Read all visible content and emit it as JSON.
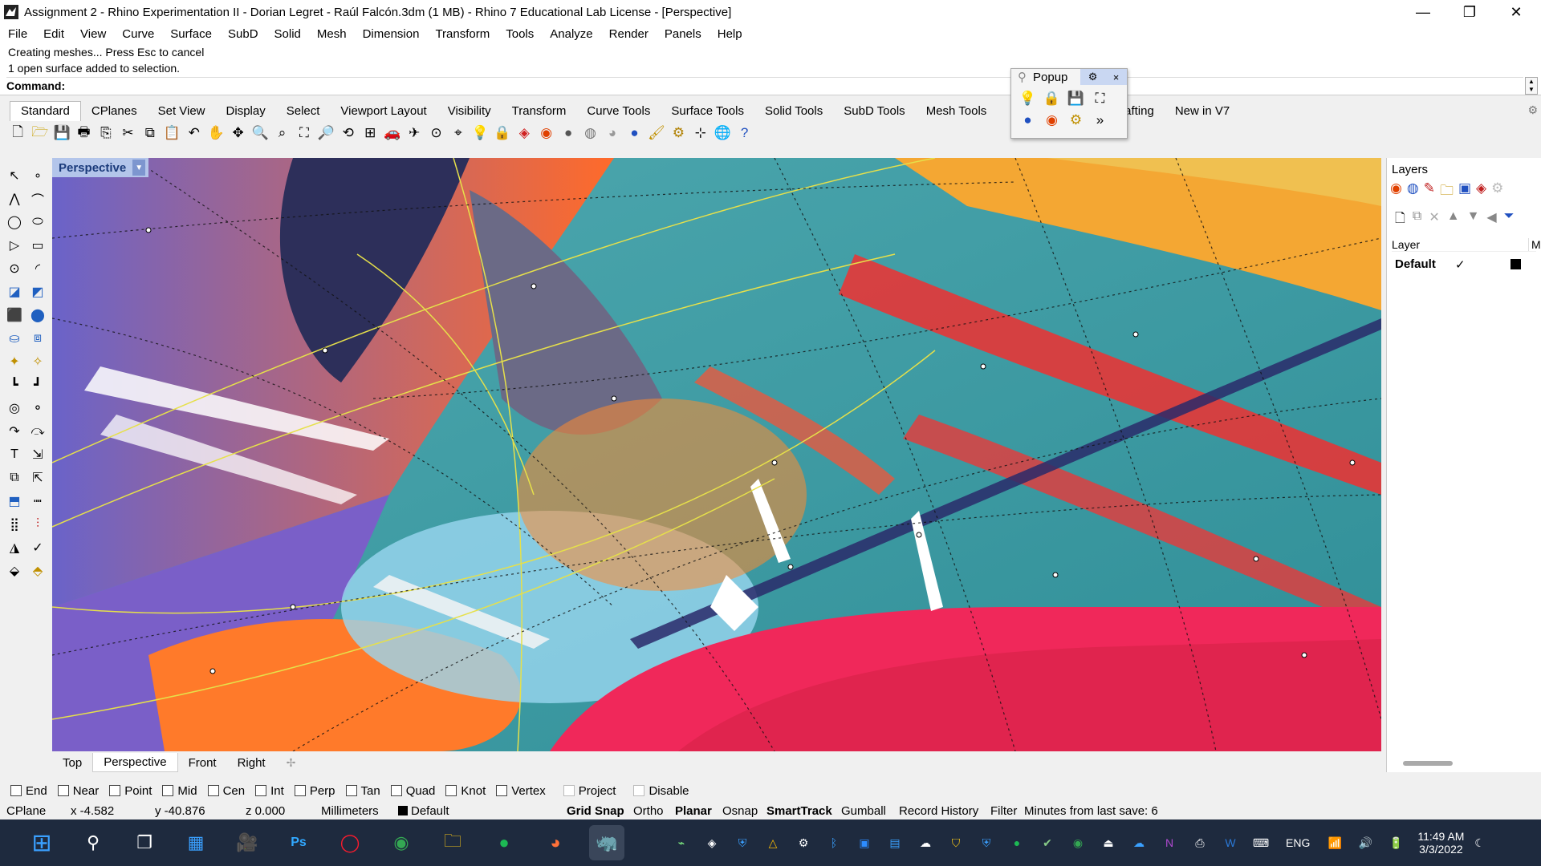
{
  "window": {
    "title": "Assignment 2 - Rhino Experimentation II - Dorian Legret - Raúl Falcón.3dm (1 MB) - Rhino 7 Educational Lab License - [Perspective]",
    "minimize_glyph": "—",
    "maximize_glyph": "❐",
    "close_glyph": "✕"
  },
  "menu": [
    "File",
    "Edit",
    "View",
    "Curve",
    "Surface",
    "SubD",
    "Solid",
    "Mesh",
    "Dimension",
    "Transform",
    "Tools",
    "Analyze",
    "Render",
    "Panels",
    "Help"
  ],
  "command": {
    "history": [
      "Creating meshes... Press Esc to cancel",
      "1 open surface added to selection."
    ],
    "prompt": "Command:"
  },
  "toolbar_tabs": [
    "Standard",
    "CPlanes",
    "Set View",
    "Display",
    "Select",
    "Viewport Layout",
    "Visibility",
    "Transform",
    "Curve Tools",
    "Surface Tools",
    "Solid Tools",
    "SubD Tools",
    "Mesh Tools",
    "Drafting",
    "New in V7"
  ],
  "active_toolbar_tab": "Standard",
  "toolbar_icons": [
    "new-icon",
    "open-icon",
    "save-icon",
    "print-icon",
    "import-icon",
    "cut-icon",
    "copy-icon",
    "paste-icon",
    "undo-icon",
    "pan-icon",
    "rotate-icon",
    "zoom-icon",
    "zoom-window-icon",
    "zoom-extents-icon",
    "zoom-selected-icon",
    "rotate-view-icon",
    "four-views-icon",
    "car-icon",
    "plane-icon",
    "cplane-icon",
    "osnap-icon",
    "light-icon",
    "lock-icon",
    "layer-icon",
    "color-wheel-icon",
    "sphere-icon",
    "shaded-sphere-icon",
    "rendered-sphere-icon",
    "blue-sphere-icon",
    "paint-icon",
    "gear-icon",
    "grid-icon",
    "globe-icon",
    "help-icon"
  ],
  "popup": {
    "title": "Popup",
    "gear_glyph": "⚙",
    "close_glyph": "×",
    "more_glyph": "»"
  },
  "viewport": {
    "label": "Perspective",
    "dropdown_glyph": "▼"
  },
  "viewport_tabs": [
    "Top",
    "Perspective",
    "Front",
    "Right"
  ],
  "active_viewport_tab": "Perspective",
  "add_view_glyph": "✢",
  "layers": {
    "panel_title": "Layers",
    "col_layer": "Layer",
    "col_material": "Ma",
    "rows": [
      {
        "name": "Default",
        "current_mark": "✓"
      }
    ]
  },
  "osnaps": [
    {
      "label": "End",
      "checked": false
    },
    {
      "label": "Near",
      "checked": false
    },
    {
      "label": "Point",
      "checked": false
    },
    {
      "label": "Mid",
      "checked": false
    },
    {
      "label": "Cen",
      "checked": false
    },
    {
      "label": "Int",
      "checked": false
    },
    {
      "label": "Perp",
      "checked": false
    },
    {
      "label": "Tan",
      "checked": false
    },
    {
      "label": "Quad",
      "checked": false
    },
    {
      "label": "Knot",
      "checked": false
    },
    {
      "label": "Vertex",
      "checked": false
    },
    {
      "label": "Project",
      "checked": false
    },
    {
      "label": "Disable",
      "checked": false
    }
  ],
  "status": {
    "cplane": "CPlane",
    "x": "x -4.582",
    "y": "y -40.876",
    "z": "z 0.000",
    "units": "Millimeters",
    "layer": "Default",
    "grid_snap": "Grid Snap",
    "ortho": "Ortho",
    "planar": "Planar",
    "osnap": "Osnap",
    "smarttrack": "SmartTrack",
    "gumball": "Gumball",
    "record_history": "Record History",
    "filter": "Filter",
    "minutes": "Minutes from last save: 6"
  },
  "taskbar": {
    "language": "ENG",
    "time": "11:49 AM",
    "date": "3/3/2022"
  },
  "colors": {
    "viewport_label_bg": "#b3c5ea",
    "taskbar_bg": "#1e2a3e"
  }
}
